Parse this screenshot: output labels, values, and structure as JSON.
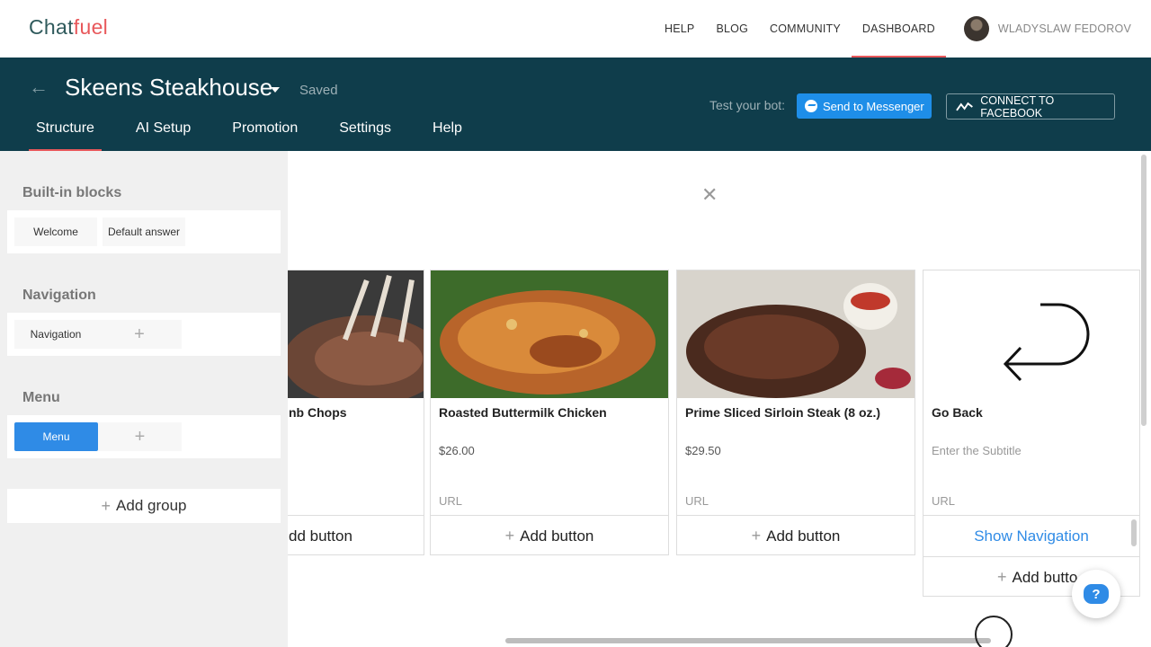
{
  "app": {
    "logo_main": "Chat",
    "logo_accent": "fuel"
  },
  "topnav": {
    "items": [
      "HELP",
      "BLOG",
      "COMMUNITY",
      "DASHBOARD"
    ],
    "user_name": "WLADYSLAW FEDOROV"
  },
  "header": {
    "bot_title": "Skeens Steakhouse",
    "saved_label": "Saved",
    "test_label": "Test your bot:",
    "send_to_messenger": "Send to Messenger",
    "connect_facebook": "CONNECT TO FACEBOOK",
    "tabs": [
      "Structure",
      "AI Setup",
      "Promotion",
      "Settings",
      "Help"
    ]
  },
  "sidebar": {
    "builtin_title": "Built-in blocks",
    "builtin_items": [
      "Welcome",
      "Default answer"
    ],
    "navigation_title": "Navigation",
    "navigation_items": [
      "Navigation"
    ],
    "menu_title": "Menu",
    "menu_items": [
      "Menu"
    ],
    "add_group_label": "Add group"
  },
  "gallery": {
    "cards": [
      {
        "title": "nb Chops",
        "price": "",
        "url": "",
        "add_button": "dd button"
      },
      {
        "title": "Roasted Buttermilk Chicken",
        "price": "$26.00",
        "url": "URL",
        "add_button": "Add button"
      },
      {
        "title": "Prime Sliced Sirloin Steak (8 oz.)",
        "price": "$29.50",
        "url": "URL",
        "add_button": "Add button"
      },
      {
        "title": "Go Back",
        "subtitle": "Enter the Subtitle",
        "url": "URL",
        "show_navigation": "Show Navigation",
        "add_button": "Add butto"
      }
    ]
  },
  "help_bubble": {
    "label": "?"
  },
  "colors": {
    "header_bg": "#0f3d4b",
    "accent_red": "#e8585b",
    "primary_blue": "#2f8be6",
    "messenger_blue": "#1e8ee8"
  }
}
